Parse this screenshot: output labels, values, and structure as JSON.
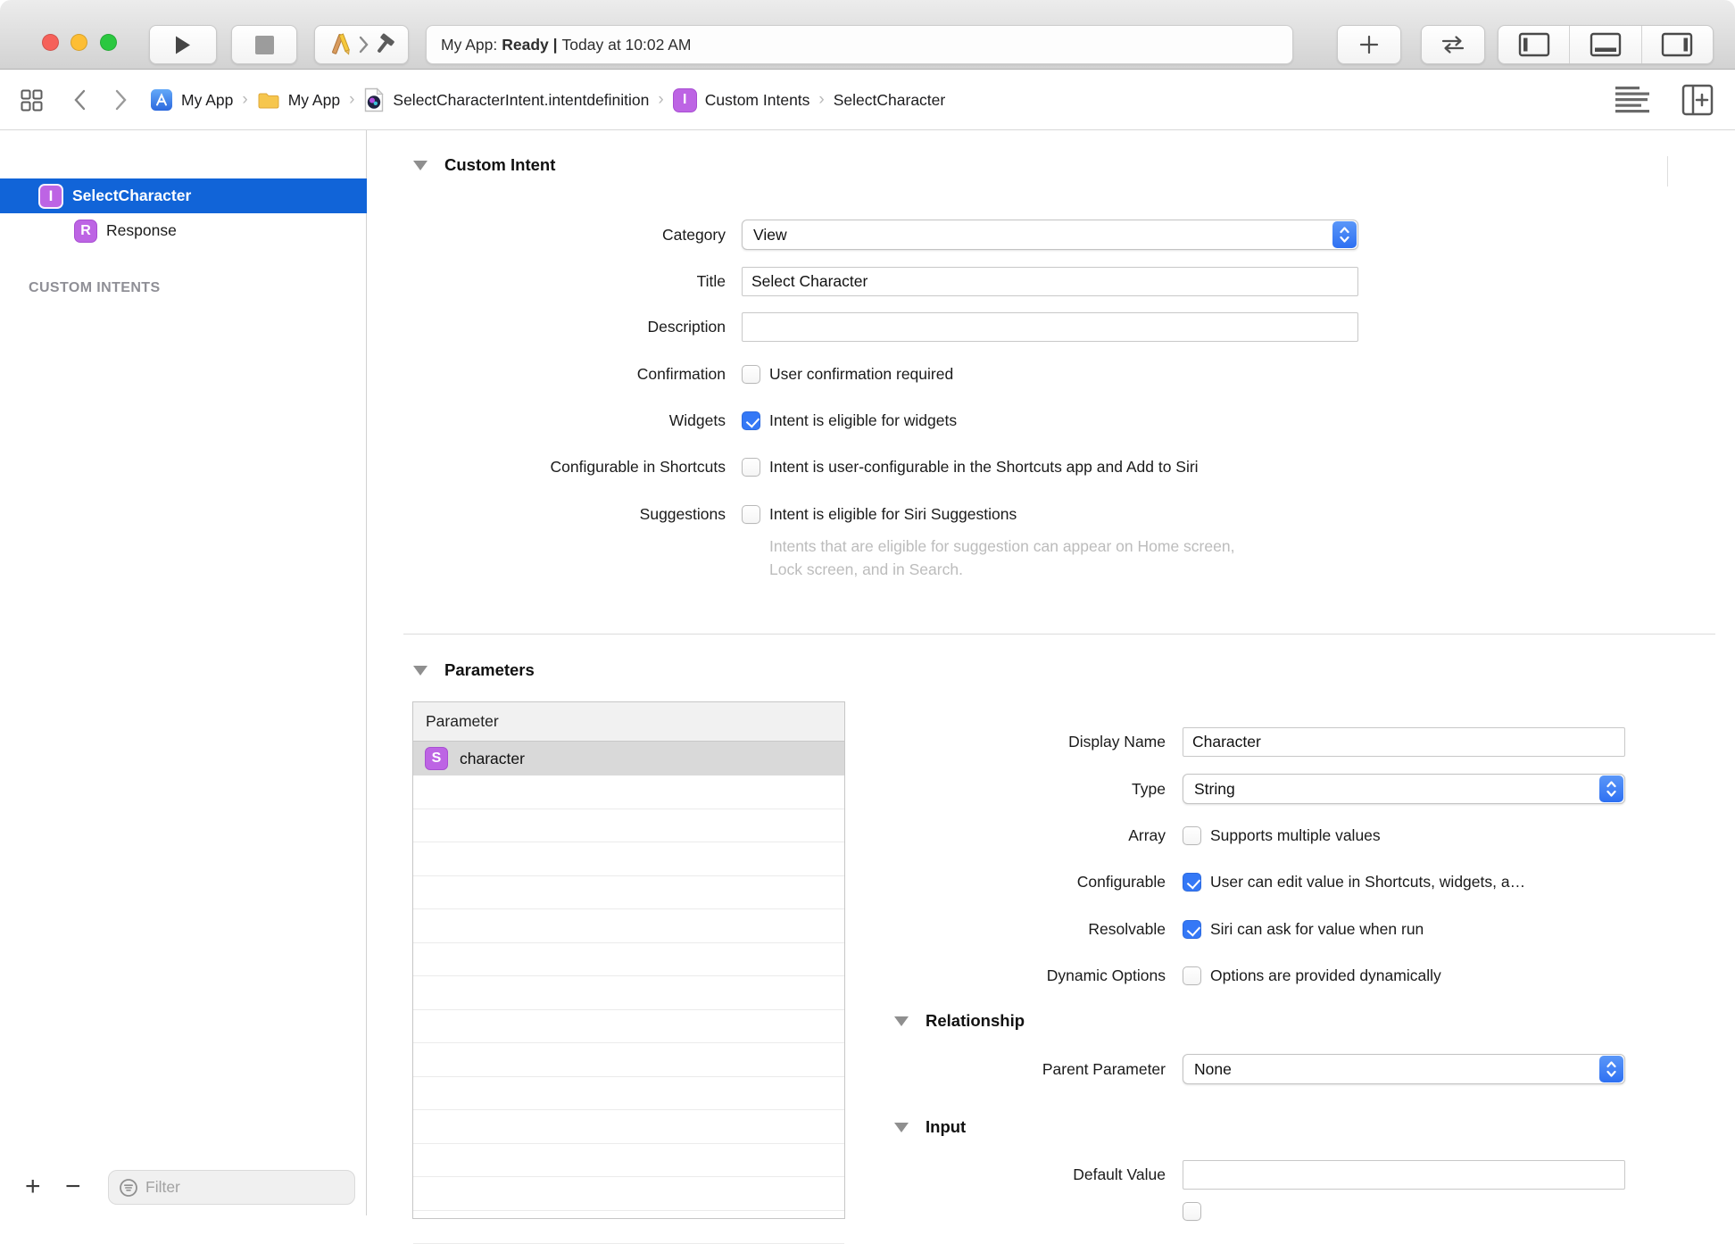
{
  "toolbar": {
    "status": {
      "app": "My App:",
      "state": "Ready |",
      "time": "Today at 10:02 AM"
    }
  },
  "jumpbar": {
    "separator": "›",
    "crumbs": [
      {
        "icon": "project-icon",
        "label": "My App"
      },
      {
        "icon": "folder-icon",
        "label": "My App"
      },
      {
        "icon": "intentdefinition-file-icon",
        "label": "SelectCharacterIntent.intentdefinition"
      },
      {
        "icon": "intent-badge",
        "badge": "I",
        "label": "Custom Intents"
      },
      {
        "label": "SelectCharacter"
      }
    ]
  },
  "sidebar": {
    "section_header": "CUSTOM INTENTS",
    "items": [
      {
        "badge": "I",
        "label": "SelectCharacter",
        "selected": true
      },
      {
        "badge": "R",
        "label": "Response",
        "selected": false
      }
    ],
    "add_glyph": "+",
    "remove_glyph": "−",
    "filter_placeholder": "Filter"
  },
  "custom_intent": {
    "section_title": "Custom Intent",
    "category": {
      "label": "Category",
      "value": "View"
    },
    "title": {
      "label": "Title",
      "value": "Select Character"
    },
    "description": {
      "label": "Description",
      "value": ""
    },
    "confirmation": {
      "label": "Confirmation",
      "text": "User confirmation required",
      "checked": false
    },
    "widgets": {
      "label": "Widgets",
      "text": "Intent is eligible for widgets",
      "checked": true
    },
    "shortcuts": {
      "label": "Configurable in Shortcuts",
      "text": "Intent is user-configurable in the Shortcuts app and Add to Siri",
      "checked": false
    },
    "suggestions": {
      "label": "Suggestions",
      "text": "Intent is eligible for Siri Suggestions",
      "checked": false
    },
    "suggestions_help_line1": "Intents that are eligible for suggestion can appear on Home screen,",
    "suggestions_help_line2": "Lock screen, and in Search."
  },
  "parameters": {
    "section_title": "Parameters",
    "table": {
      "header": "Parameter",
      "rows": [
        {
          "badge": "S",
          "name": "character"
        }
      ]
    },
    "detail": {
      "display_name": {
        "label": "Display Name",
        "value": "Character"
      },
      "type": {
        "label": "Type",
        "value": "String"
      },
      "array": {
        "label": "Array",
        "text": "Supports multiple values",
        "checked": false
      },
      "configurable": {
        "label": "Configurable",
        "text": "User can edit value in Shortcuts, widgets, a…",
        "checked": true
      },
      "resolvable": {
        "label": "Resolvable",
        "text": "Siri can ask for value when run",
        "checked": true
      },
      "dynamic_options": {
        "label": "Dynamic Options",
        "text": "Options are provided dynamically",
        "checked": false
      }
    },
    "relationship": {
      "section_title": "Relationship",
      "parent_parameter": {
        "label": "Parent Parameter",
        "value": "None"
      }
    },
    "input": {
      "section_title": "Input",
      "default_value": {
        "label": "Default Value",
        "value": ""
      }
    }
  },
  "colors": {
    "accent_blue": "#3478f6",
    "selection_blue": "#1164d8",
    "badge_purple": "#bd64e4",
    "toolbar_gray": "#dedede"
  }
}
